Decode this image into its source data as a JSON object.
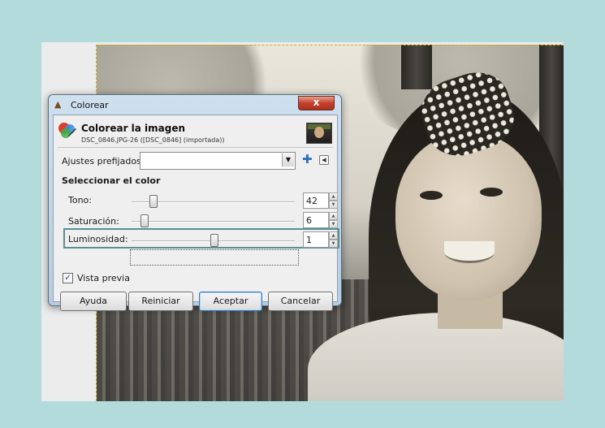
{
  "dialog": {
    "title": "Colorear",
    "header_title": "Colorear la imagen",
    "header_subtitle": "DSC_0846.JPG-26 ([DSC_0846] (importada))",
    "close_label": "x",
    "icons": {
      "title": "gimp-colorize-icon",
      "header": "color-wheel-icon",
      "add_preset": "plus-icon",
      "preset_menu": "triangle-left-icon",
      "dropdown": "chevron-down-icon",
      "thumbnail": "image-thumbnail-icon"
    }
  },
  "presets": {
    "label": "Ajustes prefijados:",
    "value": ""
  },
  "section": {
    "title": "Seleccionar el color"
  },
  "sliders": [
    {
      "label": "Tono:",
      "value": "42",
      "level": 0.1167
    },
    {
      "label": "Saturación:",
      "value": "6",
      "level": 0.06
    },
    {
      "label": "Luminosidad:",
      "value": "1",
      "level": 0.51
    }
  ],
  "preview": {
    "label": "Vista previa",
    "checked": true
  },
  "buttons": {
    "help": "Ayuda",
    "reset": "Reiniciar",
    "accept": "Aceptar",
    "cancel": "Cancelar"
  },
  "colors": {
    "background": "#b4dbdb",
    "highlight": "#5a8f92",
    "close": "#c4412b"
  }
}
